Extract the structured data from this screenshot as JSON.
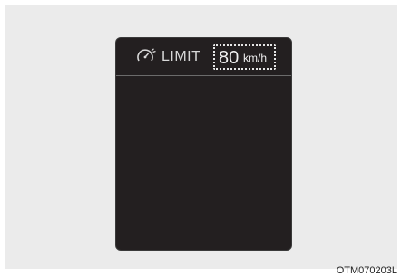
{
  "display": {
    "label": "LIMIT",
    "speed_value": "80",
    "speed_unit": "km/h",
    "icon": "speed-limiter-icon"
  },
  "figure_code": "OTM070203L"
}
